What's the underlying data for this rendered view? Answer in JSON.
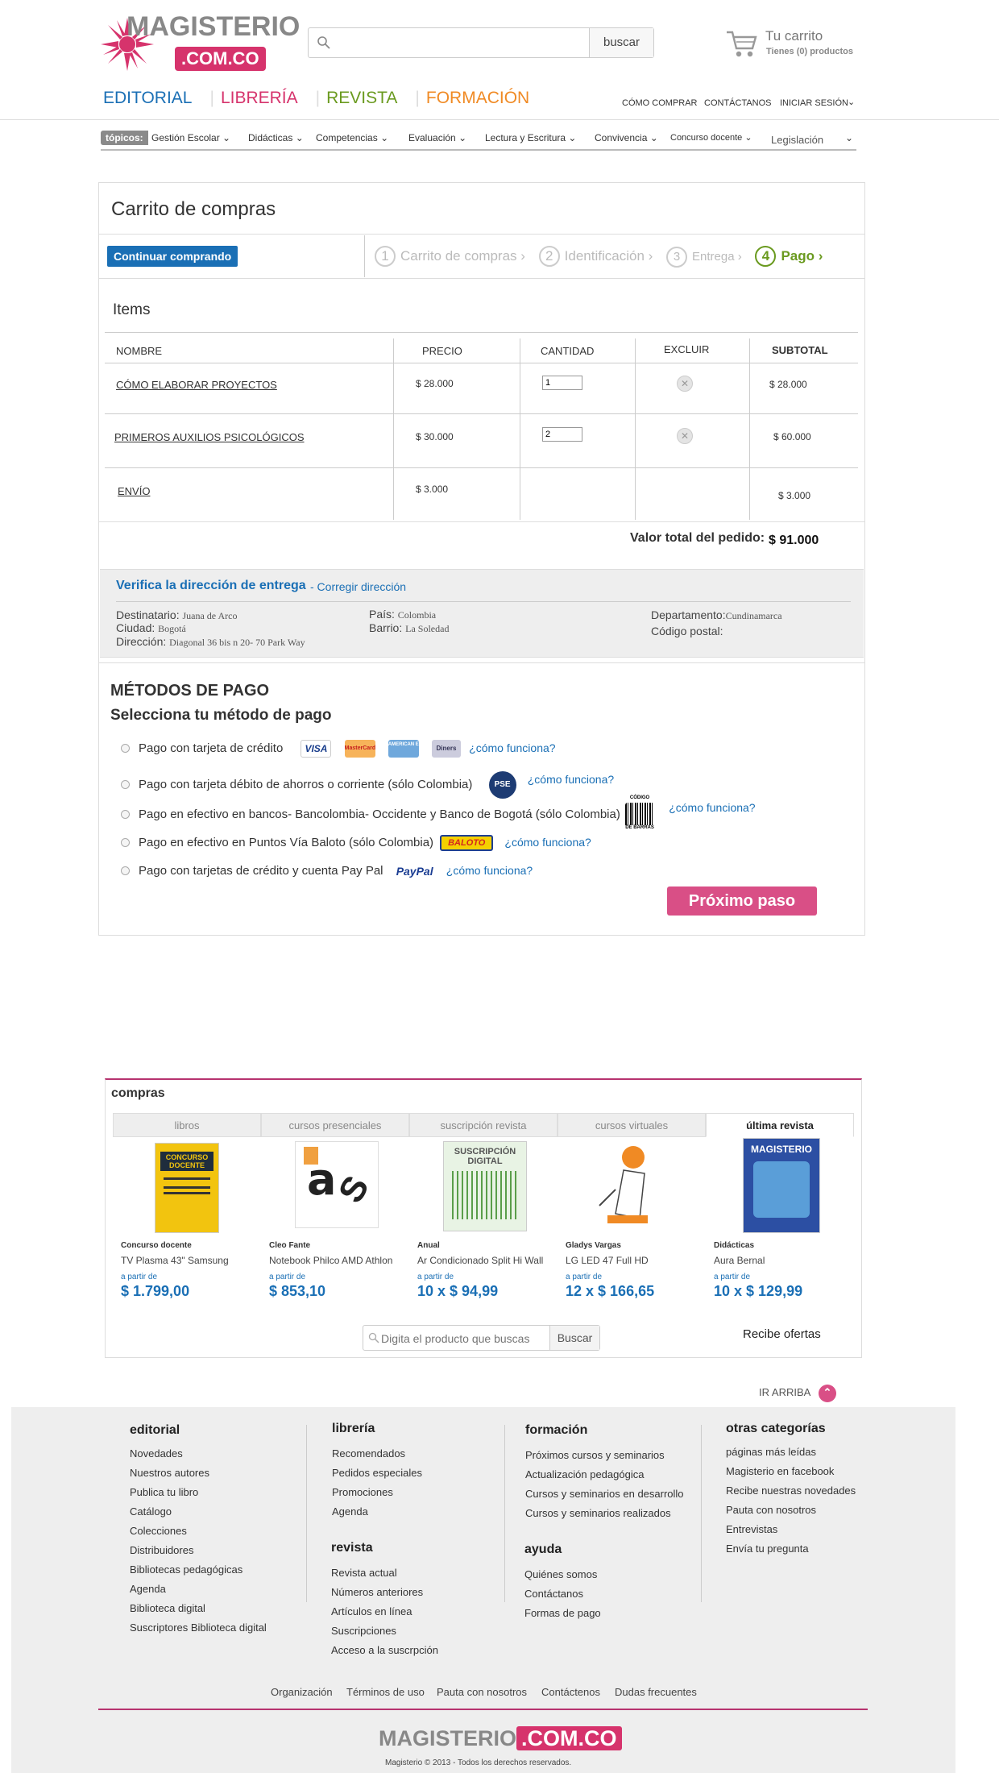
{
  "header": {
    "logo_word": "MAGISTERIO",
    "logo_domain": ".COM.CO",
    "search_placeholder": "",
    "search_button": "buscar",
    "cart_title": "Tu carrito",
    "cart_subtitle": "Tienes (0) productos",
    "nav_main": [
      {
        "label": "EDITORIAL",
        "color": "#1a6fb5"
      },
      {
        "label": "LIBRERÍA",
        "color": "#d6336c"
      },
      {
        "label": "REVISTA",
        "color": "#6a9a1f"
      },
      {
        "label": "FORMACIÓN",
        "color": "#f08a24"
      }
    ],
    "nav_top": [
      "CÓMO COMPRAR",
      "CONTÁCTANOS",
      "INICIAR SESIÓN"
    ],
    "topics_tag": "tópicos:",
    "topics": [
      "Gestión Escolar",
      "Didácticas",
      "Competencias",
      "Evaluación",
      "Lectura y Escritura",
      "Convivencia",
      "Concurso docente",
      "Legislación"
    ]
  },
  "cart": {
    "title": "Carrito de compras",
    "continue_button": "Continuar comprando",
    "steps": [
      {
        "num": "1",
        "label": "Carrito de compras ›"
      },
      {
        "num": "2",
        "label": "Identificación ›"
      },
      {
        "num": "3",
        "label": "Entrega ›"
      },
      {
        "num": "4",
        "label": "Pago"
      }
    ],
    "items_title": "Items",
    "columns": [
      "NOMBRE",
      "PRECIO",
      "CANTIDAD",
      "EXCLUIR",
      "SUBTOTAL"
    ],
    "rows": [
      {
        "name": "CÓMO ELABORAR PROYECTOS",
        "price": "$  28.000",
        "qty": "1",
        "subtotal": "$  28.000"
      },
      {
        "name": "PRIMEROS AUXILIOS PSICOLÓGICOS",
        "price": "$ 30.000",
        "qty": "2",
        "subtotal": "$ 60.000"
      },
      {
        "name": "ENVÍO",
        "price": "$ 3.000",
        "subtotal": "$ 3.000"
      }
    ],
    "total_label": "Valor total del pedido:",
    "total_value": "$ 91.000"
  },
  "address": {
    "title": "Verifica la dirección de entrega",
    "link": "- Corregir dirección",
    "destinatario_label": "Destinatario:",
    "destinatario": "Juana de Arco",
    "ciudad_label": "Ciudad:",
    "ciudad": "Bogotá",
    "direccion_label": "Dirección:",
    "direccion": "Diagonal 36 bis n 20- 70 Park Way",
    "pais_label": "País:",
    "pais": "Colombia",
    "barrio_label": "Barrio:",
    "barrio": "La Soledad",
    "depto_label": "Departamento:",
    "depto": "Cundinamarca",
    "postal_label": "Código postal:",
    "postal": ""
  },
  "payment": {
    "title": "MÉTODOS DE PAGO",
    "subtitle": "Selecciona tu método de pago",
    "how": "¿cómo funciona?",
    "options": [
      "Pago con tarjeta de crédito",
      "Pago con tarjeta débito de ahorros o corriente (sólo Colombia)",
      "Pago en efectivo en bancos- Bancolombia- Occidente y Banco de Bogotá (sólo Colombia)",
      "Pago en efectivo en Puntos Vía Baloto (sólo Colombia)",
      "Pago con tarjetas de crédito y cuenta Pay Pal"
    ],
    "card_logos": [
      "VISA",
      "MasterCard",
      "AMERICAN EXPRESS",
      "Diners"
    ],
    "pse_logo": "PSE",
    "barcode_top": "CÓDIGO",
    "barcode_bottom": "DE BARRAS",
    "baloto_logo": "BALOTO",
    "paypal_logo": "PayPal",
    "next_button": "Próximo paso"
  },
  "compras": {
    "title": "compras",
    "tabs": [
      "libros",
      "cursos presenciales",
      "suscripción revista",
      "cursos virtuales",
      "última revista"
    ],
    "products": [
      {
        "category": "Concurso docente",
        "name": "TV Plasma 43\" Samsung",
        "from": "a partir de",
        "price": "$ 1.799,00",
        "img_text": "CONCURSO DOCENTE"
      },
      {
        "category": "Cleo Fante",
        "name": "Notebook Philco AMD Athlon",
        "from": "a partir de",
        "price": "$ 853,10",
        "img_text": "a"
      },
      {
        "category": "Anual",
        "name": "Ar Condicionado Split Hi Wall",
        "from": "a partir de",
        "price": "10 x $ 94,99",
        "img_text": "SUSCRIPCIÓN DIGITAL"
      },
      {
        "category": "Gladys Vargas",
        "name": "LG LED 47 Full HD",
        "from": "a partir de",
        "price": "12 x $ 166,65",
        "img_text": ""
      },
      {
        "category": "Didácticas",
        "name": "Aura Bernal",
        "from": "a partir de",
        "price": "10 x $ 129,99",
        "img_text": "MAGISTERIO"
      }
    ],
    "search_placeholder": "Digita el producto que buscas",
    "search_button": "Buscar",
    "offers": "Recibe ofertas"
  },
  "ir_arriba": "IR ARRIBA",
  "footer": {
    "cols": [
      {
        "title": "editorial",
        "links": [
          "Novedades",
          "Nuestros autores",
          "Publica tu libro",
          "Catálogo",
          "Colecciones",
          "Distribuidores",
          "Bibliotecas pedagógicas",
          "Agenda",
          "Biblioteca digital",
          "Suscriptores Biblioteca digital"
        ]
      },
      {
        "title": "librería",
        "links": [
          "Recomendados",
          "Pedidos especiales",
          "Promociones",
          "Agenda"
        ]
      },
      {
        "title": "revista",
        "links": [
          "Revista actual",
          "Números anteriores",
          "Artículos en línea",
          "Suscripciones",
          "Acceso a la suscrpción"
        ]
      },
      {
        "title": "formación",
        "links": [
          "Próximos cursos y seminarios",
          "Actualización pedagógica",
          "Cursos y seminarios en desarrollo",
          "Cursos y seminarios realizados"
        ]
      },
      {
        "title": "ayuda",
        "links": [
          "Quiénes somos",
          "Contáctanos",
          "Formas de pago"
        ]
      },
      {
        "title": "otras categorías",
        "links": [
          "páginas más leídas",
          "Magisterio en facebook",
          "Recibe nuestras novedades",
          "Pauta con nosotros",
          "Entrevistas",
          "Envía tu pregunta"
        ]
      }
    ],
    "bottom_links": [
      "Organización",
      "Términos de uso",
      "Pauta con nosotros",
      "Contáctenos",
      "Dudas frecuentes"
    ],
    "logo_word": "MAGISTERIO",
    "logo_domain": ".COM.CO",
    "copyright": "Magisterio © 2013 - Todos los derechos reservados."
  }
}
